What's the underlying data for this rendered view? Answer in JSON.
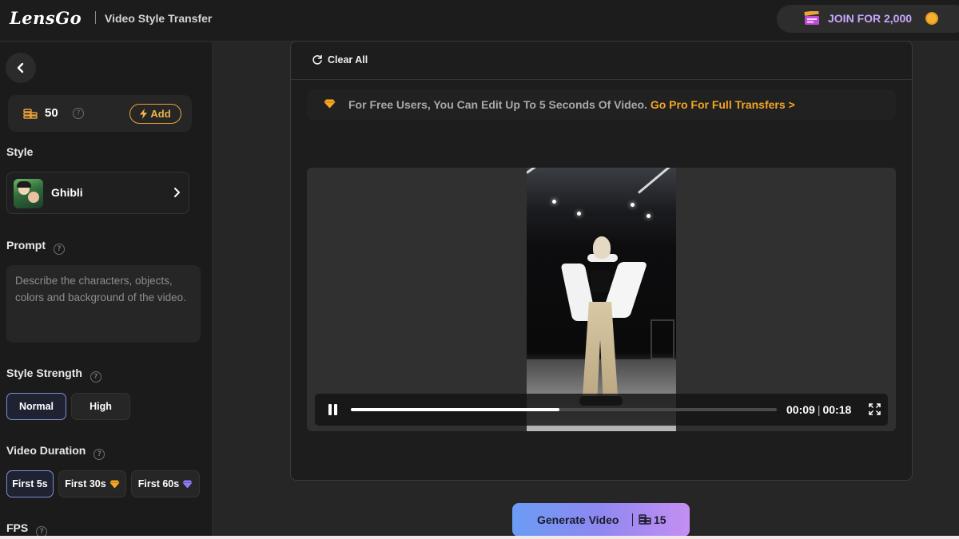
{
  "header": {
    "logo": "LensGo",
    "title": "Video Style Transfer",
    "join_label": "JOIN FOR 2,000"
  },
  "sidebar": {
    "credits": "50",
    "help": "?",
    "add_label": "Add",
    "style_label": "Style",
    "style_name": "Ghibli",
    "prompt_label": "Prompt",
    "prompt_placeholder": "Describe the characters, objects, colors and background of the video.",
    "style_strength_label": "Style Strength",
    "strength_options": [
      "Normal",
      "High"
    ],
    "strength_selected": "Normal",
    "duration_label": "Video Duration",
    "duration_options": [
      "First 5s",
      "First 30s",
      "First 60s"
    ],
    "duration_selected": "First 5s",
    "fps_label": "FPS"
  },
  "panel": {
    "clear_all": "Clear All",
    "notice_text": "For Free Users, You Can Edit Up To 5 Seconds Of Video.",
    "notice_link": "Go Pro For Full Transfers >"
  },
  "player": {
    "current_time": "00:09",
    "time_separator": "|",
    "total_time": "00:18",
    "progress": 0.49
  },
  "generate": {
    "label": "Generate Video",
    "cost": "15"
  },
  "colors": {
    "accent_orange": "#f5a623",
    "accent_purple": "#c8a6ff",
    "selected_border": "#7c8ed6"
  }
}
